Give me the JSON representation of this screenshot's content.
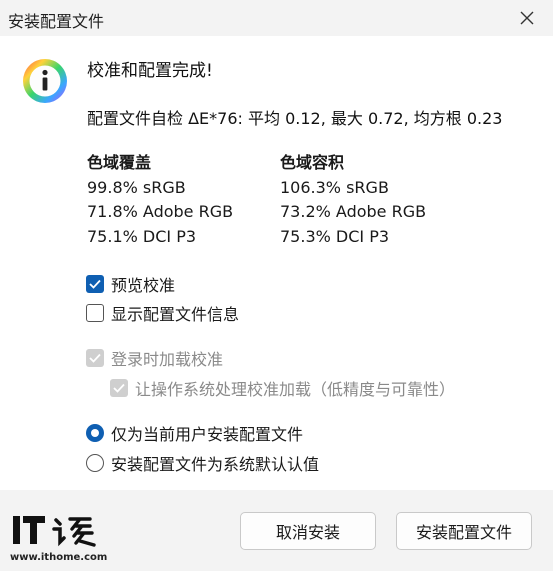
{
  "window": {
    "title": "安装配置文件"
  },
  "main": {
    "heading": "校准和配置完成!",
    "profile_check": "配置文件自检 ΔE*76: 平均 0.12, 最大 0.72, 均方根 0.23",
    "gamut_coverage": {
      "title": "色域覆盖",
      "rows": [
        "99.8% sRGB",
        "71.8% Adobe RGB",
        "75.1% DCI P3"
      ]
    },
    "gamut_volume": {
      "title": "色域容积",
      "rows": [
        "106.3% sRGB",
        "73.2% Adobe RGB",
        "75.3% DCI P3"
      ]
    },
    "checkboxes": {
      "preview": "预览校准",
      "show_info": "显示配置文件信息",
      "load_on_login": "登录时加载校准",
      "let_os_handle": "让操作系统处理校准加载（低精度与可靠性）"
    },
    "radios": {
      "current_user": "仅为当前用户安装配置文件",
      "system_default": "安装配置文件为系统默认认值"
    }
  },
  "footer": {
    "cancel_label": "取消安装",
    "install_label": "安装配置文件",
    "watermark_url": "www.ithome.com"
  },
  "colors": {
    "accent": "#0f5fb2"
  }
}
